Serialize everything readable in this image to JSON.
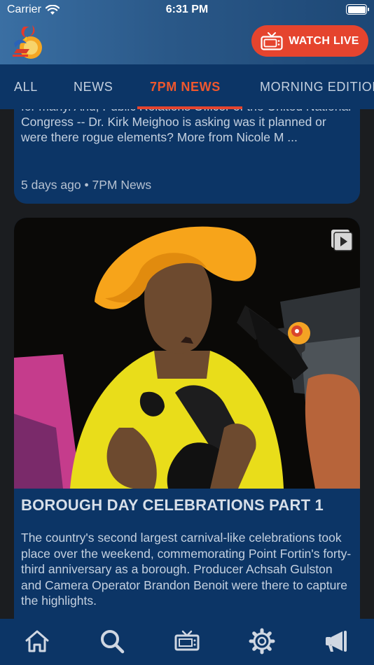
{
  "status_bar": {
    "carrier": "Carrier",
    "time": "6:31 PM"
  },
  "header": {
    "watch_live_label": "WATCH LIVE"
  },
  "tabs": [
    {
      "label": "ALL",
      "active": false
    },
    {
      "label": "NEWS",
      "active": false
    },
    {
      "label": "7PM NEWS",
      "active": true
    },
    {
      "label": "MORNING EDITION",
      "active": false
    }
  ],
  "feed": {
    "items": [
      {
        "excerpt_partial": "for many. And, Public Relations Officer of the United National Congress -- Dr. Kirk Meighoo is asking was it planned or were there rogue elements? More from Nicole M ...",
        "meta": "5 days ago • 7PM News"
      },
      {
        "title": "BOROUGH DAY CELEBRATIONS PART 1",
        "excerpt": "The country's second largest carnival-like celebrations took place over the weekend, commemorating Point Fortin's forty-third anniversary as a borough. Producer Achsah Gulston and Camera Operator Brandon Benoit were there to capture the highlights."
      }
    ]
  },
  "bottom_nav": [
    "home-icon",
    "search-icon",
    "tv-icon",
    "settings-icon",
    "megaphone-icon"
  ],
  "colors": {
    "accent": "#e5442e",
    "panel": "#0c3566",
    "background": "#1b1d20"
  }
}
